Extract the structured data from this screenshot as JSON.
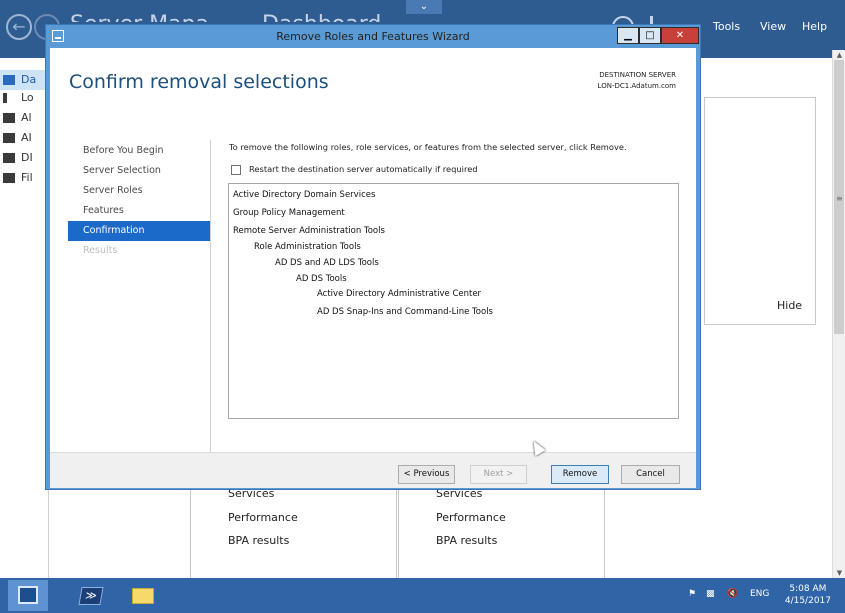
{
  "server_manager": {
    "title_fragments": [
      "Server Manager",
      "Dashboard"
    ],
    "menu": [
      "Tools",
      "View",
      "Help"
    ],
    "nav_items": [
      {
        "label": "Da",
        "icon": "dashboard-icon",
        "active": true
      },
      {
        "label": "Lo",
        "icon": "local-server-icon",
        "active": false
      },
      {
        "label": "Al",
        "icon": "all-servers-icon",
        "active": false
      },
      {
        "label": "AI",
        "icon": "ad-ds-icon",
        "active": false
      },
      {
        "label": "DI",
        "icon": "dns-icon",
        "active": false
      },
      {
        "label": "Fil",
        "icon": "file-services-icon",
        "active": false
      }
    ],
    "hide_label": "Hide",
    "tiles": [
      {
        "lines": [
          "Services",
          "Performance",
          "BPA results"
        ]
      },
      {
        "lines": [
          "Services",
          "Performance",
          "BPA results"
        ]
      }
    ]
  },
  "wizard": {
    "title": "Remove Roles and Features Wizard",
    "heading": "Confirm removal selections",
    "destination_label": "DESTINATION SERVER",
    "destination_value": "LON-DC1.Adatum.com",
    "steps": [
      {
        "label": "Before You Begin",
        "state": "normal"
      },
      {
        "label": "Server Selection",
        "state": "normal"
      },
      {
        "label": "Server Roles",
        "state": "normal"
      },
      {
        "label": "Features",
        "state": "normal"
      },
      {
        "label": "Confirmation",
        "state": "active"
      },
      {
        "label": "Results",
        "state": "disabled"
      }
    ],
    "instruction": "To remove the following roles, role services, or features from the selected server, click Remove.",
    "restart_label": "Restart the destination server automatically if required",
    "restart_checked": false,
    "items": [
      {
        "label": "Active Directory Domain Services",
        "level": 0
      },
      {
        "label": "Group Policy Management",
        "level": 0
      },
      {
        "label": "Remote Server Administration Tools",
        "level": 0
      },
      {
        "label": "Role Administration Tools",
        "level": 1
      },
      {
        "label": "AD DS and AD LDS Tools",
        "level": 2
      },
      {
        "label": "AD DS Tools",
        "level": 3
      },
      {
        "label": "Active Directory Administrative Center",
        "level": 4
      },
      {
        "label": "AD DS Snap-Ins and Command-Line Tools",
        "level": 4
      }
    ],
    "buttons": {
      "previous": "< Previous",
      "next": "Next >",
      "remove": "Remove",
      "cancel": "Cancel"
    }
  },
  "taskbar": {
    "language": "ENG",
    "time": "5:08 AM",
    "date": "4/15/2017"
  }
}
